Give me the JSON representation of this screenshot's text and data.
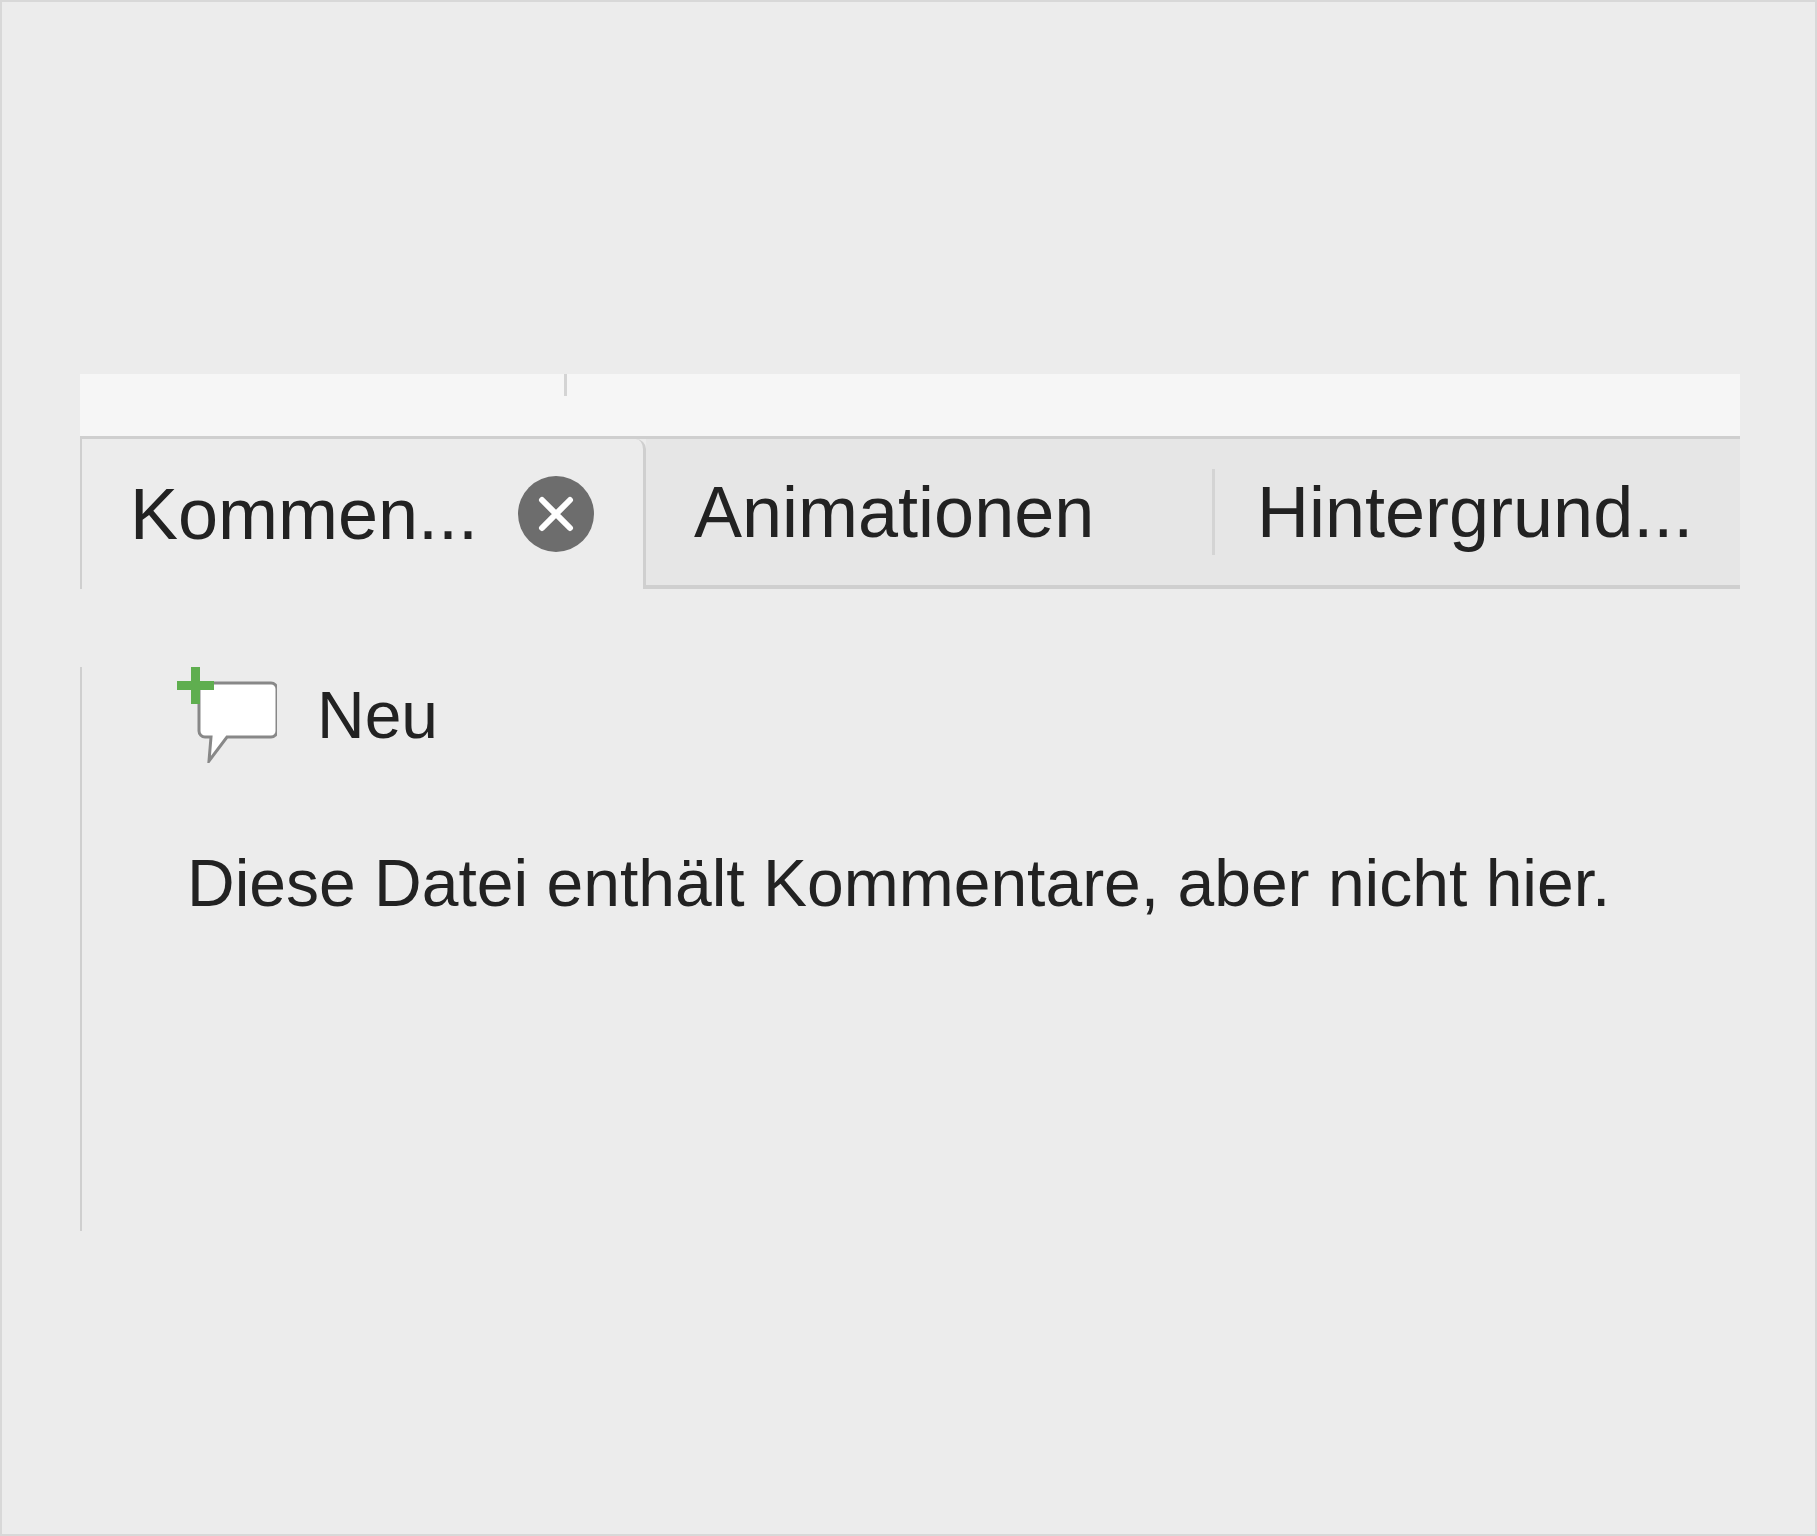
{
  "tabs": [
    {
      "label": "Kommen...",
      "selected": true
    },
    {
      "label": "Animationen",
      "selected": false
    },
    {
      "label": "Hintergrund...",
      "selected": false
    }
  ],
  "new_button": {
    "label": "Neu"
  },
  "message": "Diese Datei enthält Kommentare, aber nicht hier."
}
